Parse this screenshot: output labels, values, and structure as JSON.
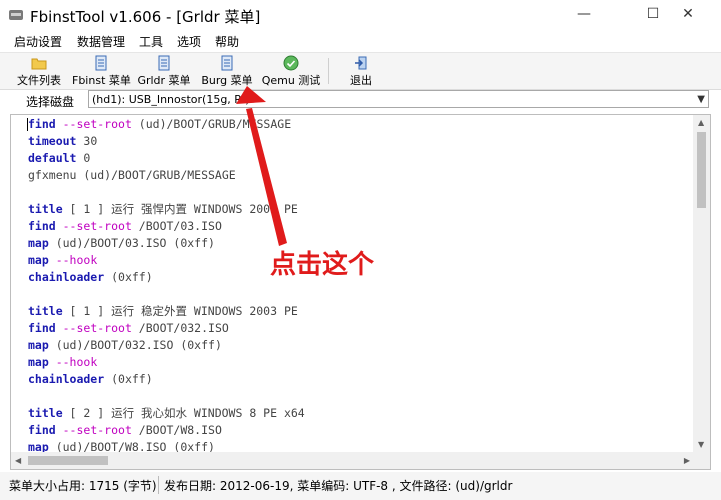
{
  "window": {
    "title": "FbinstTool v1.606 - [Grldr 菜单]",
    "minimize_glyph": "—",
    "maximize_glyph": "☐",
    "close_glyph": "✕"
  },
  "menu": {
    "items": [
      "启动设置",
      "数据管理",
      "工具",
      "选项",
      "帮助"
    ]
  },
  "toolbar": {
    "buttons": [
      {
        "label": "文件列表",
        "icon": "folder-icon"
      },
      {
        "label": "Fbinst 菜单",
        "icon": "document-icon"
      },
      {
        "label": "Grldr 菜单",
        "icon": "document-icon"
      },
      {
        "label": "Burg 菜单",
        "icon": "document-icon"
      },
      {
        "label": "Qemu 测试",
        "icon": "check-circle-icon"
      },
      {
        "label": "退出",
        "icon": "exit-door-icon"
      }
    ]
  },
  "disk": {
    "label": "选择磁盘",
    "selected": "(hd1): USB_Innostor(15g, R:)"
  },
  "editor": {
    "lines": [
      [
        {
          "t": "kw",
          "v": "find"
        },
        {
          "t": "opt",
          "v": " --set-root"
        },
        {
          "t": "txt",
          "v": " (ud)/BOOT/GRUB/MESSAGE"
        }
      ],
      [
        {
          "t": "kw",
          "v": "timeout"
        },
        {
          "t": "num",
          "v": " 30"
        }
      ],
      [
        {
          "t": "kw",
          "v": "default"
        },
        {
          "t": "num",
          "v": " 0"
        }
      ],
      [
        {
          "t": "txt",
          "v": "gfxmenu (ud)/BOOT/GRUB/MESSAGE"
        }
      ],
      [],
      [
        {
          "t": "kw",
          "v": "title"
        },
        {
          "t": "txt",
          "v": " [ 1 ] 运行 强悍内置 WINDOWS 2003 PE"
        }
      ],
      [
        {
          "t": "kw",
          "v": "find"
        },
        {
          "t": "opt",
          "v": " --set-root"
        },
        {
          "t": "txt",
          "v": " /BOOT/03.ISO"
        }
      ],
      [
        {
          "t": "kw",
          "v": "map"
        },
        {
          "t": "txt",
          "v": " (ud)/BOOT/03.ISO (0xff)"
        }
      ],
      [
        {
          "t": "kw",
          "v": "map"
        },
        {
          "t": "opt",
          "v": " --hook"
        }
      ],
      [
        {
          "t": "kw",
          "v": "chainloader"
        },
        {
          "t": "txt",
          "v": " (0xff)"
        }
      ],
      [],
      [
        {
          "t": "kw",
          "v": "title"
        },
        {
          "t": "txt",
          "v": " [ 1 ] 运行 稳定外置 WINDOWS 2003 PE"
        }
      ],
      [
        {
          "t": "kw",
          "v": "find"
        },
        {
          "t": "opt",
          "v": " --set-root"
        },
        {
          "t": "txt",
          "v": " /BOOT/032.ISO"
        }
      ],
      [
        {
          "t": "kw",
          "v": "map"
        },
        {
          "t": "txt",
          "v": " (ud)/BOOT/032.ISO (0xff)"
        }
      ],
      [
        {
          "t": "kw",
          "v": "map"
        },
        {
          "t": "opt",
          "v": " --hook"
        }
      ],
      [
        {
          "t": "kw",
          "v": "chainloader"
        },
        {
          "t": "txt",
          "v": " (0xff)"
        }
      ],
      [],
      [
        {
          "t": "kw",
          "v": "title"
        },
        {
          "t": "txt",
          "v": " [ 2 ] 运行 我心如水 WINDOWS 8 PE x64"
        }
      ],
      [
        {
          "t": "kw",
          "v": "find"
        },
        {
          "t": "opt",
          "v": " --set-root"
        },
        {
          "t": "txt",
          "v": " /BOOT/W8.ISO"
        }
      ],
      [
        {
          "t": "kw",
          "v": "map"
        },
        {
          "t": "txt",
          "v": " (ud)/BOOT/W8.ISO (0xff)"
        }
      ]
    ]
  },
  "status": {
    "size": "菜单大小占用: 1715 (字节)",
    "info": "发布日期: 2012-06-19, 菜单编码: UTF-8 , 文件路径: (ud)/grldr"
  },
  "annotation": {
    "text": "点击这个",
    "color": "#e01b1b"
  },
  "colors": {
    "keyword": "#1a1ab0",
    "option": "#c000c0",
    "annotation": "#e01b1b"
  }
}
